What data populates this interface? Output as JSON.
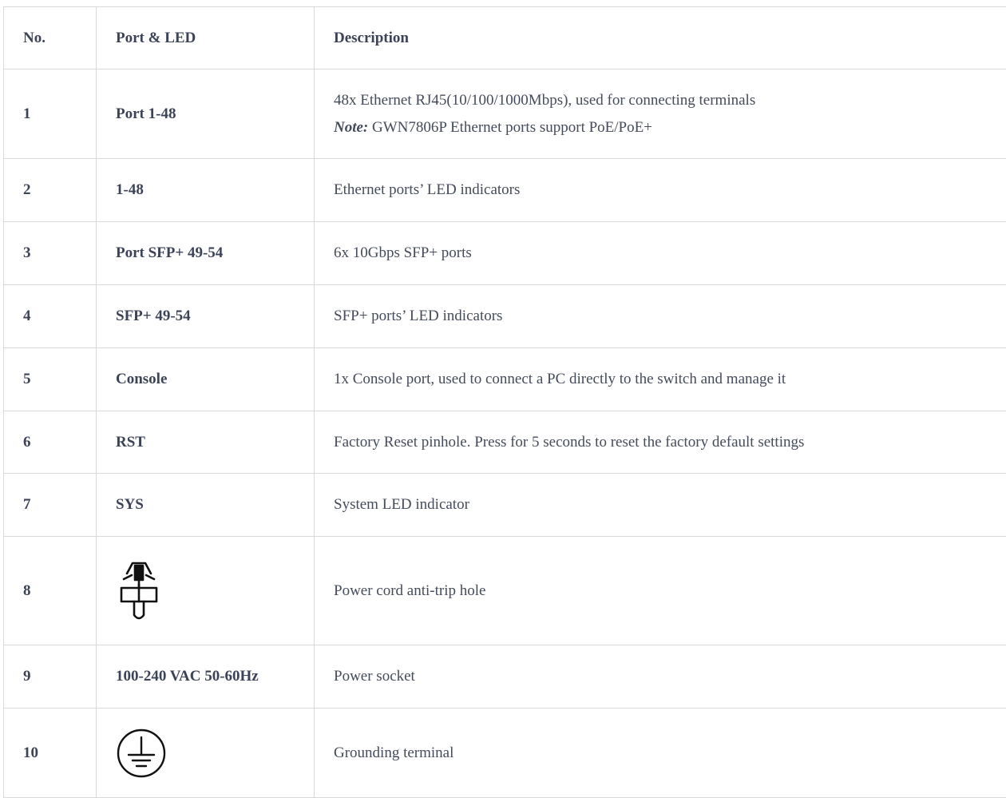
{
  "table": {
    "headers": {
      "no": "No.",
      "port": "Port & LED",
      "description": "Description"
    },
    "rows": [
      {
        "no": "1",
        "port": "Port 1-48",
        "description": "48x Ethernet RJ45(10/100/1000Mbps), used for connecting terminals",
        "note_label": "Note:",
        "note_text": " GWN7806P Ethernet ports support PoE/PoE+"
      },
      {
        "no": "2",
        "port": "1-48",
        "description": "Ethernet ports’ LED indicators"
      },
      {
        "no": "3",
        "port": "Port SFP+ 49-54",
        "description": "6x 10Gbps SFP+ ports"
      },
      {
        "no": "4",
        "port": "SFP+ 49-54",
        "description": "SFP+ ports’ LED indicators"
      },
      {
        "no": "5",
        "port": "Console",
        "description": "1x Console port, used to connect a PC directly to the switch and manage it"
      },
      {
        "no": "6",
        "port": "RST",
        "description": "Factory Reset pinhole. Press for 5 seconds to reset the factory default settings"
      },
      {
        "no": "7",
        "port": "SYS",
        "description": "System LED indicator"
      },
      {
        "no": "8",
        "port_icon": "anti-trip-clip-icon",
        "description": "Power cord anti-trip hole"
      },
      {
        "no": "9",
        "port": "100-240 VAC 50-60Hz",
        "description": "Power socket"
      },
      {
        "no": "10",
        "port_icon": "grounding-symbol-icon",
        "description": "Grounding terminal"
      }
    ]
  }
}
